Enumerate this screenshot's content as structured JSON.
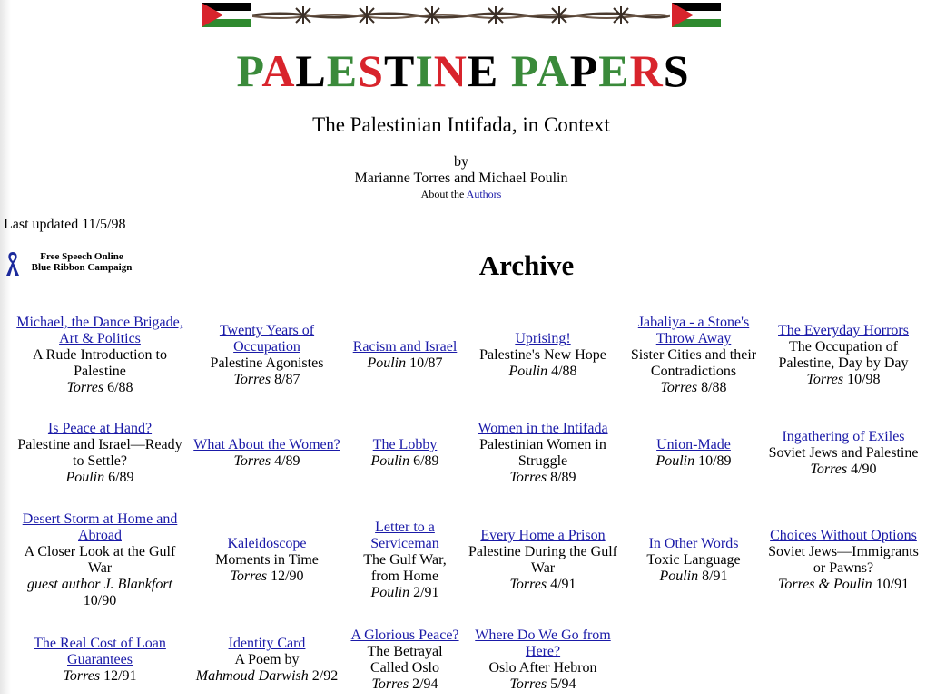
{
  "header": {
    "title_parts": [
      {
        "t": "P",
        "c": "green"
      },
      {
        "t": "A",
        "c": "red"
      },
      {
        "t": "L",
        "c": "black"
      },
      {
        "t": "E",
        "c": "green"
      },
      {
        "t": "S",
        "c": "red"
      },
      {
        "t": "T",
        "c": "black"
      },
      {
        "t": "I",
        "c": "green"
      },
      {
        "t": "N",
        "c": "red"
      },
      {
        "t": "E",
        "c": "black"
      },
      {
        "t": " ",
        "c": "black"
      },
      {
        "t": "P",
        "c": "green"
      },
      {
        "t": "A",
        "c": "green"
      },
      {
        "t": "P",
        "c": "black"
      },
      {
        "t": "E",
        "c": "green"
      },
      {
        "t": "R",
        "c": "red"
      },
      {
        "t": "S",
        "c": "black"
      }
    ],
    "subtitle": "The Palestinian Intifada, in Context",
    "by": "by",
    "authors": "Marianne Torres and Michael Poulin",
    "about_prefix": "About the",
    "about_link": "Authors",
    "last_updated": "Last updated 11/5/98"
  },
  "ribbon": {
    "line1": "Free Speech Online",
    "line2": "Blue Ribbon Campaign"
  },
  "archive_heading": "Archive",
  "colors": {
    "link": "#1a1aa8",
    "green": "#3a8a3a",
    "red": "#d8242c",
    "black": "#000000"
  },
  "articles": [
    {
      "row": 1,
      "link": "Michael, the Dance Brigade, Art & Politics",
      "desc": "A Rude Introduction to Palestine",
      "author": "Torres",
      "date": "6/88"
    },
    {
      "row": 1,
      "link": "Twenty Years of Occupation",
      "desc": "Palestine Agonistes",
      "author": "Torres",
      "date": "8/87"
    },
    {
      "row": 1,
      "link": "Racism and Israel",
      "desc": "",
      "author": "Poulin",
      "date": "10/87"
    },
    {
      "row": 1,
      "link": "Uprising!",
      "desc": "Palestine's New Hope",
      "author": "Poulin",
      "date": "4/88"
    },
    {
      "row": 1,
      "link": "Jabaliya - a Stone's Throw Away",
      "desc": "Sister Cities and their Contradictions",
      "author": "Torres",
      "date": "8/88"
    },
    {
      "row": 1,
      "link": "The Everyday Horrors",
      "desc": "The Occupation of Palestine, Day by Day",
      "author": "Torres",
      "date": "10/98"
    },
    {
      "row": 2,
      "link": "Is Peace at Hand?",
      "desc": "Palestine and Israel—Ready to Settle?",
      "author": "Poulin",
      "date": "6/89"
    },
    {
      "row": 2,
      "link": "What About the Women?",
      "desc": "",
      "author": "Torres",
      "date": "4/89"
    },
    {
      "row": 2,
      "link": "The Lobby",
      "desc": "",
      "author": "Poulin",
      "date": "6/89"
    },
    {
      "row": 2,
      "link": "Women in the Intifada",
      "desc": "Palestinian Women in Struggle",
      "author": "Torres",
      "date": "8/89"
    },
    {
      "row": 2,
      "link": "Union-Made",
      "desc": "",
      "author": "Poulin",
      "date": "10/89"
    },
    {
      "row": 2,
      "link": "Ingathering of Exiles",
      "desc": "Soviet Jews and Palestine",
      "author": "Torres",
      "date": "4/90"
    },
    {
      "row": 3,
      "link": "Desert Storm at Home and Abroad",
      "desc": "A Closer Look at the Gulf War",
      "author": "guest author J. Blankfort",
      "date": "10/90"
    },
    {
      "row": 3,
      "link": "Kaleidoscope",
      "desc": "Moments in Time",
      "author": "Torres",
      "date": "12/90"
    },
    {
      "row": 3,
      "link": "Letter to a Serviceman",
      "desc": "The Gulf War, from Home",
      "author": "Poulin",
      "date": "2/91"
    },
    {
      "row": 3,
      "link": "Every Home a Prison",
      "desc": "Palestine During the Gulf War",
      "author": "Torres",
      "date": "4/91"
    },
    {
      "row": 3,
      "link": "In Other Words",
      "desc": "Toxic Language",
      "author": "Poulin",
      "date": "8/91"
    },
    {
      "row": 3,
      "link": "Choices Without Options",
      "desc": "Soviet Jews—Immigrants or Pawns?",
      "author": "Torres & Poulin",
      "date": "10/91"
    },
    {
      "row": 4,
      "link": "The Real Cost of Loan Guarantees",
      "desc": "",
      "author": "Torres",
      "date": "12/91"
    },
    {
      "row": 4,
      "link": "Identity Card",
      "desc": "A Poem by",
      "author": "Mahmoud Darwish",
      "date": "2/92"
    },
    {
      "row": 4,
      "link": "A Glorious Peace?",
      "desc": "The Betrayal Called Oslo",
      "author": "Torres",
      "date": "2/94"
    },
    {
      "row": 4,
      "link": "Where Do We Go from Here?",
      "desc": "Oslo After Hebron",
      "author": "Torres",
      "date": "5/94"
    },
    {
      "row": 4,
      "link": "",
      "desc": "",
      "author": "",
      "date": ""
    },
    {
      "row": 4,
      "link": "",
      "desc": "",
      "author": "",
      "date": ""
    }
  ]
}
